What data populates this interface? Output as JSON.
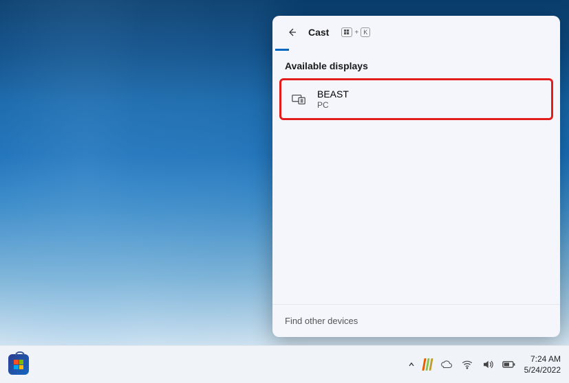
{
  "panel": {
    "title": "Cast",
    "shortcut_key": "K",
    "section_title": "Available displays",
    "footer_link": "Find other devices"
  },
  "devices": [
    {
      "name": "BEAST",
      "type": "PC"
    }
  ],
  "taskbar": {
    "time": "7:24 AM",
    "date": "5/24/2022"
  }
}
